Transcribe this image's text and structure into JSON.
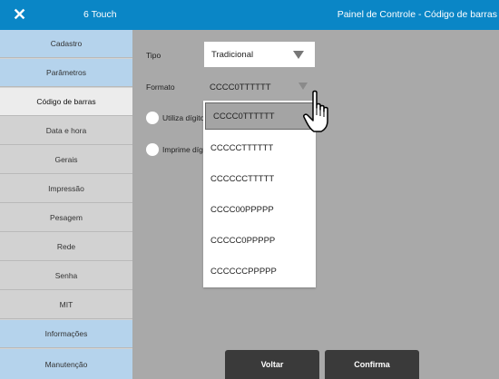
{
  "titlebar": {
    "close_glyph": "✕",
    "app_name": "6 Touch",
    "title": "Painel de Controle - Código de barras"
  },
  "sidebar": {
    "items": [
      {
        "label": "Cadastro",
        "state": "blue"
      },
      {
        "label": "Parâmetros",
        "state": "blue"
      },
      {
        "label": "Código de barras",
        "state": "active"
      },
      {
        "label": "Data e hora",
        "state": "gray"
      },
      {
        "label": "Gerais",
        "state": "gray"
      },
      {
        "label": "Impressão",
        "state": "gray"
      },
      {
        "label": "Pesagem",
        "state": "gray"
      },
      {
        "label": "Rede",
        "state": "gray"
      },
      {
        "label": "Senha",
        "state": "gray"
      },
      {
        "label": "MIT",
        "state": "gray"
      },
      {
        "label": "Informações",
        "state": "blue"
      },
      {
        "label": "Manutenção",
        "state": "blue"
      }
    ]
  },
  "form": {
    "tipo_label": "Tipo",
    "tipo_value": "Tradicional",
    "formato_label": "Formato",
    "formato_value": "CCCC0TTTTTT",
    "utiliza_label": "Utiliza dígito",
    "imprime_label": "Imprime díg"
  },
  "dropdown": {
    "options": [
      "CCCC0TTTTTT",
      "CCCCCTTTTTT",
      "CCCCCCTTTTT",
      "CCCC00PPPPP",
      "CCCCC0PPPPP",
      "CCCCCCPPPPP"
    ],
    "selected_index": 0
  },
  "buttons": {
    "voltar": "Voltar",
    "confirma": "Confirma"
  },
  "colors": {
    "titlebar": "#0a86c6",
    "sidebar_blue": "#b5d3ec",
    "sidebar_gray": "#d2d2d2",
    "sidebar_active": "#ececec",
    "main_bg": "#a9a9a9",
    "button": "#3a3a3a"
  },
  "icons": {
    "close": "close-icon",
    "cursor": "hand-pointer-icon",
    "dropdown_arrow": "triangle-down-icon"
  }
}
